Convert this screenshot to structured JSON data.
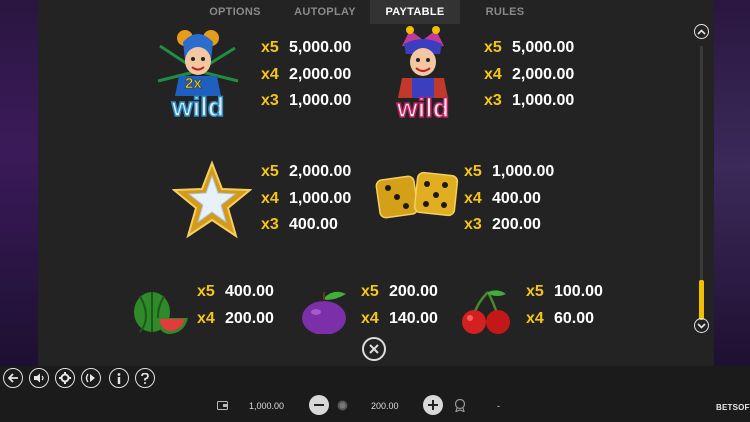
{
  "tabs": [
    {
      "label": "OPTIONS",
      "active": false
    },
    {
      "label": "AUTOPLAY",
      "active": false
    },
    {
      "label": "PAYTABLE",
      "active": true
    },
    {
      "label": "RULES",
      "active": false
    }
  ],
  "symbols": {
    "wild_2x": {
      "wild_text": "wild",
      "multiplier_text": "2x",
      "pays": [
        {
          "mult": "x5",
          "value": "5,000.00"
        },
        {
          "mult": "x4",
          "value": "2,000.00"
        },
        {
          "mult": "x3",
          "value": "1,000.00"
        }
      ]
    },
    "wild": {
      "wild_text": "wild",
      "pays": [
        {
          "mult": "x5",
          "value": "5,000.00"
        },
        {
          "mult": "x4",
          "value": "2,000.00"
        },
        {
          "mult": "x3",
          "value": "1,000.00"
        }
      ]
    },
    "star": {
      "pays": [
        {
          "mult": "x5",
          "value": "2,000.00"
        },
        {
          "mult": "x4",
          "value": "1,000.00"
        },
        {
          "mult": "x3",
          "value": "400.00"
        }
      ]
    },
    "dice": {
      "pays": [
        {
          "mult": "x5",
          "value": "1,000.00"
        },
        {
          "mult": "x4",
          "value": "400.00"
        },
        {
          "mult": "x3",
          "value": "200.00"
        }
      ]
    },
    "watermelon": {
      "pays": [
        {
          "mult": "x5",
          "value": "400.00"
        },
        {
          "mult": "x4",
          "value": "200.00"
        }
      ]
    },
    "plum": {
      "pays": [
        {
          "mult": "x5",
          "value": "200.00"
        },
        {
          "mult": "x4",
          "value": "140.00"
        }
      ]
    },
    "cherry": {
      "pays": [
        {
          "mult": "x5",
          "value": "100.00"
        },
        {
          "mult": "x4",
          "value": "60.00"
        }
      ]
    }
  },
  "bottom_bar": {
    "balance": "1,000.00",
    "bet": "200.00",
    "win": "-",
    "brand": "BETSOFT"
  },
  "colors": {
    "accent": "#f5c518",
    "panel": "#232323"
  }
}
